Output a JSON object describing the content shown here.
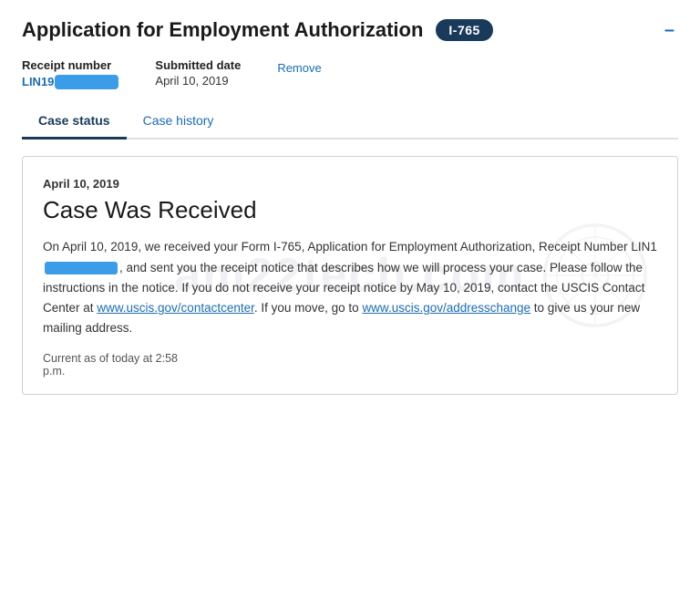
{
  "header": {
    "title": "Application for Employment Authorization",
    "badge": "I-765",
    "minimize_btn": "–"
  },
  "meta": {
    "receipt_label": "Receipt number",
    "receipt_prefix": "LIN19",
    "submitted_label": "Submitted date",
    "submitted_value": "April 10, 2019",
    "remove_label": "Remove"
  },
  "tabs": [
    {
      "id": "case-status",
      "label": "Case status",
      "active": true
    },
    {
      "id": "case-history",
      "label": "Case history",
      "active": false
    }
  ],
  "status_card": {
    "date": "April 10, 2019",
    "title": "Case Was Received",
    "body_part1": "On April 10, 2019, we received your Form I-765, Application for Employment Authorization, Receipt Number LIN1",
    "body_part2": ", and sent you the receipt notice that describes how we will process your case. Please follow the instructions in the notice. If you do not receive your receipt notice by May 10, 2019, contact the USCIS Contact Center at ",
    "link1_text": "www.uscis.gov/contactcenter",
    "link1_href": "www.uscis.gov/contactcenter",
    "body_part3": ". If you move, go to ",
    "link2_text": "www.uscis.gov/addresschange",
    "link2_href": "www.uscis.gov/addresschange",
    "body_part4": " to give us your new mailing address.",
    "current_as_of_line1": "Current as of today at 2:58",
    "current_as_of_line2": "p.m.",
    "watermark_text": "am22tech.com"
  }
}
